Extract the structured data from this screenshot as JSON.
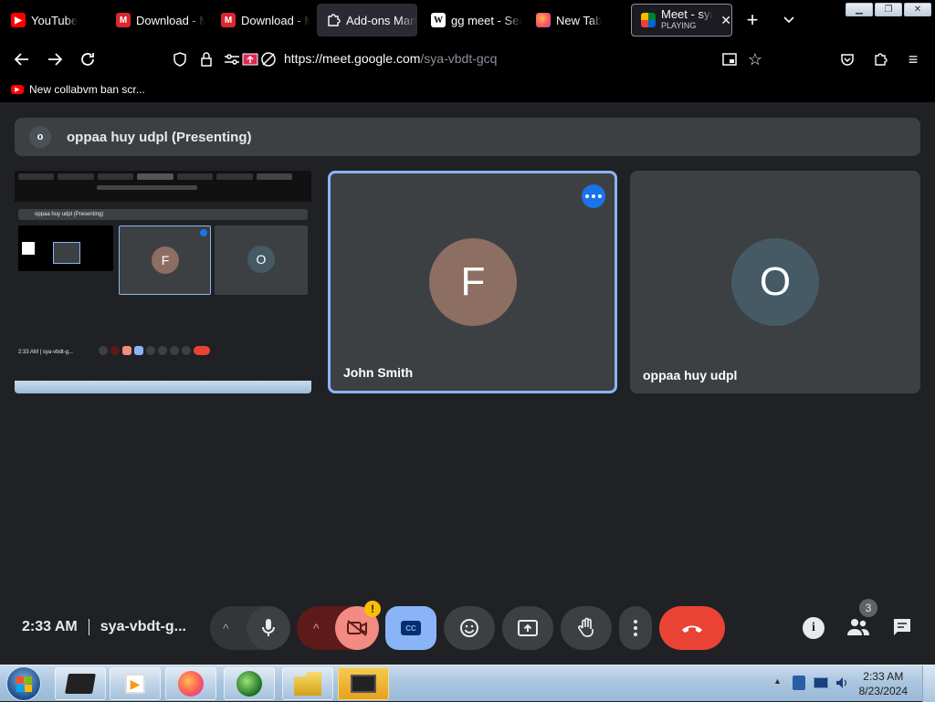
{
  "browser": {
    "tabs": [
      {
        "label": "YouTube",
        "icon": "youtube-icon"
      },
      {
        "label": "Download - M",
        "icon": "mega-icon"
      },
      {
        "label": "Download - M",
        "icon": "mega-icon"
      },
      {
        "label": "Add-ons Man",
        "icon": "puzzle-icon"
      },
      {
        "label": "gg meet - Sea",
        "icon": "wikipedia-icon"
      },
      {
        "label": "New Tab",
        "icon": "firefox-icon"
      },
      {
        "label": "Meet - sya",
        "sublabel": "PLAYING",
        "icon": "google-meet-icon"
      }
    ],
    "url_host": "https://meet.google.com",
    "url_path": "/sya-vbdt-gcq",
    "bookmark": "New collabvm ban scr...",
    "wiki_glyph": "W",
    "mega_glyph": "M"
  },
  "meet": {
    "presenting_initial": "o",
    "presenting_label": "oppaa huy udpl (Presenting)",
    "tiles": [
      {
        "name": "John Smith",
        "initial": "F",
        "avatar_color": "#8d6e63"
      },
      {
        "name": "oppaa huy udpl",
        "initial": "O",
        "avatar_color": "#455a64"
      }
    ],
    "mini": {
      "presenting_label": "oppaa huy udpl (Presenting)",
      "tile_initials": [
        "F",
        "O"
      ],
      "time": "2:33 AM",
      "code": "sya-vbdt-g..."
    },
    "bottom": {
      "time": "2:33 AM",
      "meeting_code": "sya-vbdt-g...",
      "cc_label": "CC",
      "warning_glyph": "!",
      "people_count": "3"
    },
    "colors": {
      "accent_blue": "#8ab4f8",
      "end_call_red": "#ea4335",
      "camera_off": "#f28b82"
    }
  },
  "taskbar": {
    "time": "2:33 AM",
    "date": "8/23/2024"
  }
}
